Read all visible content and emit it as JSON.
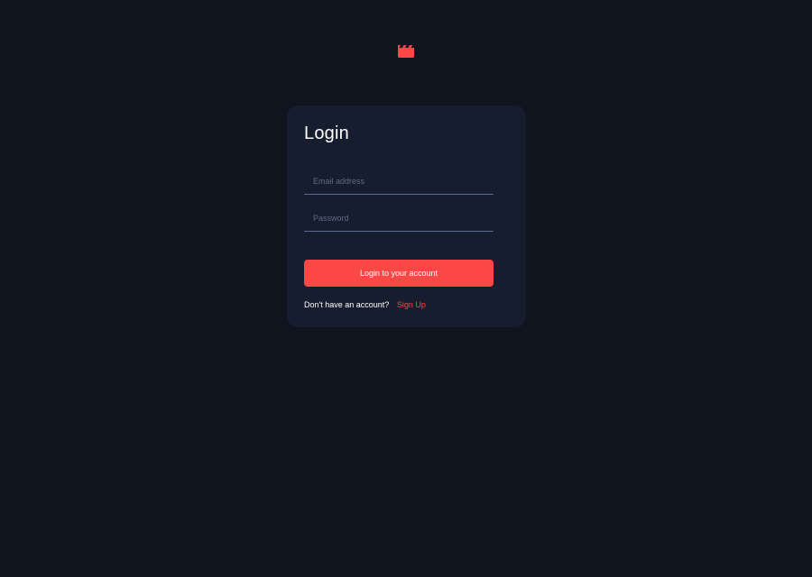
{
  "app": {
    "logo_icon": "movie-clapperboard-icon",
    "accent_color": "#fc4747"
  },
  "login": {
    "title": "Login",
    "email": {
      "value": "",
      "placeholder": "Email address"
    },
    "password": {
      "value": "",
      "placeholder": "Password"
    },
    "submit_label": "Login to your account",
    "signup_prompt": "Don't have an account?",
    "signup_link": "Sign Up"
  }
}
